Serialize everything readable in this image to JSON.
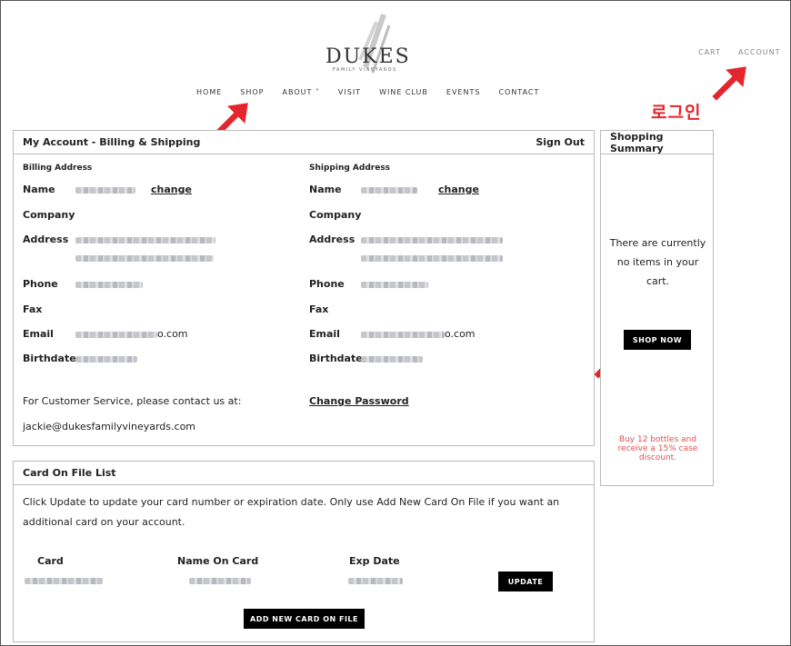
{
  "header": {
    "logo_word": "DUKES",
    "logo_sub": "FAMILY VINEYARDS",
    "cart": "CART",
    "account": "ACCOUNT",
    "nav": [
      "HOME",
      "SHOP",
      "ABOUT ˅",
      "VISIT",
      "WINE CLUB",
      "EVENTS",
      "CONTACT"
    ]
  },
  "annotation": {
    "login_label": "로그인",
    "arrow_color": "#e3262b"
  },
  "account_panel": {
    "title": "My Account - Billing & Shipping",
    "sign_out": "Sign Out",
    "billing": {
      "heading": "Billing Address",
      "name_label": "Name",
      "change": "change",
      "company_label": "Company",
      "address_label": "Address",
      "phone_label": "Phone",
      "fax_label": "Fax",
      "email_label": "Email",
      "email_suffix": "o.com",
      "birthdate_label": "Birthdate"
    },
    "shipping": {
      "heading": "Shipping Address",
      "name_label": "Name",
      "change": "change",
      "company_label": "Company",
      "address_label": "Address",
      "phone_label": "Phone",
      "fax_label": "Fax",
      "email_label": "Email",
      "email_suffix": "o.com",
      "birthdate_label": "Birthdate"
    },
    "customer_service": "For Customer Service, please contact us at:",
    "contact_email": "jackie@dukesfamilyvineyards.com",
    "change_password": "Change Password"
  },
  "cards_panel": {
    "title": "Card On File List",
    "instructions_line1": "Click Update to update your card number or expiration date. Only use Add New Card On File if you want an",
    "instructions_line2": "additional card on your account.",
    "col_card": "Card",
    "col_name": "Name On Card",
    "col_exp": "Exp Date",
    "update": "UPDATE",
    "add_new": "ADD NEW CARD ON FILE"
  },
  "summary_panel": {
    "title": "Shopping Summary",
    "empty_line1": "There are currently",
    "empty_line2": "no items in your",
    "empty_line3": "cart.",
    "shop_now": "SHOP NOW",
    "promo_line1": "Buy 12 bottles and",
    "promo_line2": "receive a 15% case",
    "promo_line3": "discount."
  }
}
